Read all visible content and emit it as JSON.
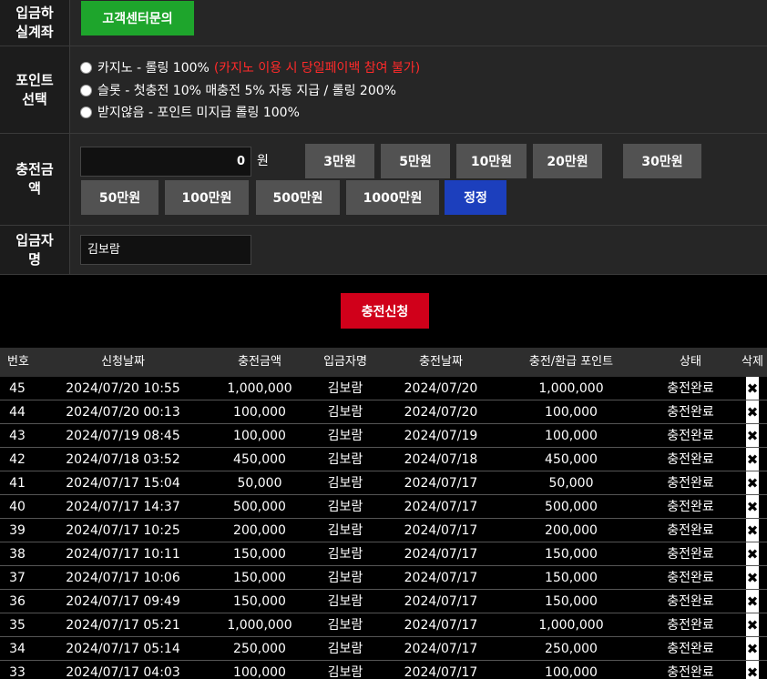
{
  "deposit_account": {
    "label": "입금하\n실계좌",
    "button": "고객센터문의"
  },
  "point_select": {
    "label": "포인트\n선택",
    "options": [
      {
        "text": "카지노 - 롤링 100%",
        "warning": "(카지노 이용 시 당일페이백 참여 불가)"
      },
      {
        "text": "슬롯 - 첫충전 10% 매충전 5% 자동 지급 / 롤링 200%",
        "warning": ""
      },
      {
        "text": "받지않음 - 포인트 미지급 롤링 100%",
        "warning": ""
      }
    ]
  },
  "charge_amount": {
    "label": "충전금\n액",
    "value": "0",
    "unit": "원",
    "buttons_row1": [
      "3만원",
      "5만원",
      "10만원",
      "20만원",
      "30만원"
    ],
    "buttons_row2": [
      "50만원",
      "100만원",
      "500만원",
      "1000만원"
    ],
    "correct_button": "정정"
  },
  "depositor": {
    "label": "입금자\n명",
    "value": "김보람"
  },
  "submit_button": "충전신청",
  "colors": {
    "green": "#1ea52c",
    "red": "#d0001a",
    "blue": "#1c3fbd",
    "warning": "#ff2a2a"
  },
  "table": {
    "headers": [
      "번호",
      "신청날짜",
      "충전금액",
      "입금자명",
      "충전날짜",
      "충전/환급 포인트",
      "상태",
      "삭제"
    ],
    "delete_icon": "✖",
    "rows": [
      [
        "45",
        "2024/07/20 10:55",
        "1,000,000",
        "김보람",
        "2024/07/20",
        "1,000,000",
        "충전완료"
      ],
      [
        "44",
        "2024/07/20 00:13",
        "100,000",
        "김보람",
        "2024/07/20",
        "100,000",
        "충전완료"
      ],
      [
        "43",
        "2024/07/19 08:45",
        "100,000",
        "김보람",
        "2024/07/19",
        "100,000",
        "충전완료"
      ],
      [
        "42",
        "2024/07/18 03:52",
        "450,000",
        "김보람",
        "2024/07/18",
        "450,000",
        "충전완료"
      ],
      [
        "41",
        "2024/07/17 15:04",
        "50,000",
        "김보람",
        "2024/07/17",
        "50,000",
        "충전완료"
      ],
      [
        "40",
        "2024/07/17 14:37",
        "500,000",
        "김보람",
        "2024/07/17",
        "500,000",
        "충전완료"
      ],
      [
        "39",
        "2024/07/17 10:25",
        "200,000",
        "김보람",
        "2024/07/17",
        "200,000",
        "충전완료"
      ],
      [
        "38",
        "2024/07/17 10:11",
        "150,000",
        "김보람",
        "2024/07/17",
        "150,000",
        "충전완료"
      ],
      [
        "37",
        "2024/07/17 10:06",
        "150,000",
        "김보람",
        "2024/07/17",
        "150,000",
        "충전완료"
      ],
      [
        "36",
        "2024/07/17 09:49",
        "150,000",
        "김보람",
        "2024/07/17",
        "150,000",
        "충전완료"
      ],
      [
        "35",
        "2024/07/17 05:21",
        "1,000,000",
        "김보람",
        "2024/07/17",
        "1,000,000",
        "충전완료"
      ],
      [
        "34",
        "2024/07/17 05:14",
        "250,000",
        "김보람",
        "2024/07/17",
        "250,000",
        "충전완료"
      ],
      [
        "33",
        "2024/07/17 04:03",
        "100,000",
        "김보람",
        "2024/07/17",
        "100,000",
        "충전완료"
      ]
    ]
  }
}
